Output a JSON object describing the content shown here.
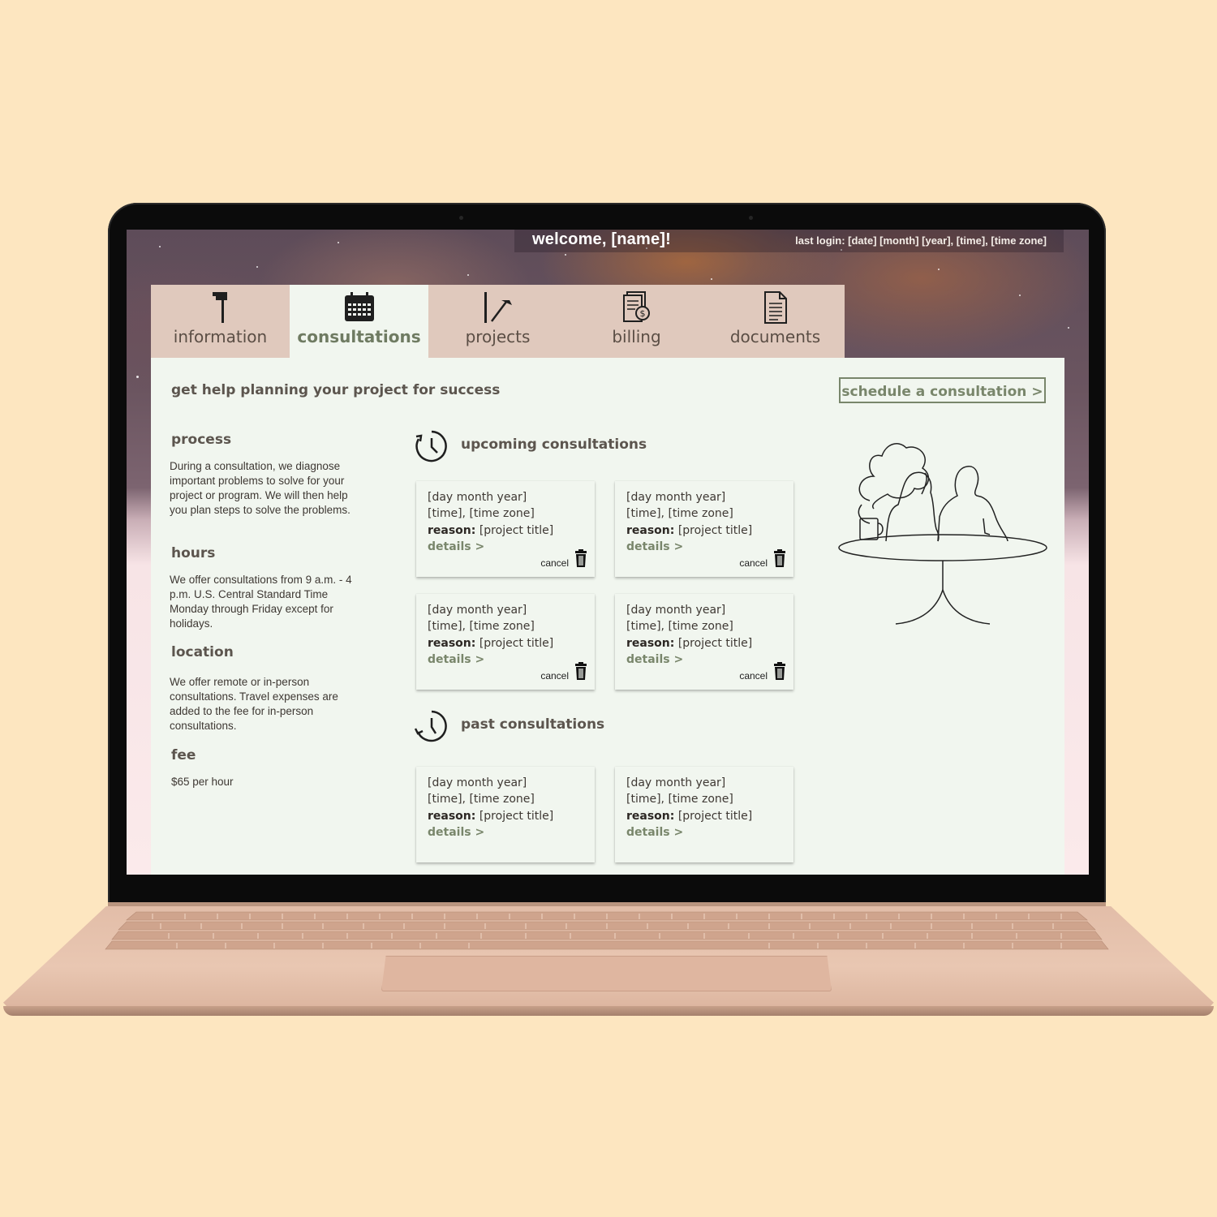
{
  "header": {
    "welcome": "welcome, [name]!",
    "last_login": "last login: [date] [month] [year], [time], [time zone]"
  },
  "tabs": [
    {
      "label": "information",
      "icon": "mailbox-icon"
    },
    {
      "label": "consultations",
      "icon": "calendar-icon"
    },
    {
      "label": "projects",
      "icon": "hammer-icon"
    },
    {
      "label": "billing",
      "icon": "invoice-icon"
    },
    {
      "label": "documents",
      "icon": "document-icon"
    }
  ],
  "active_tab": "consultations",
  "main": {
    "headline": "get help planning your project for success",
    "schedule_button": "schedule a consultation  >",
    "info": {
      "process_title": "process",
      "process_text": "During a consultation, we diagnose important problems to solve for your project or program.  We will then help you plan steps to solve the problems.",
      "hours_title": "hours",
      "hours_text": "We offer consultations from 9 a.m. - 4 p.m. U.S. Central Standard Time Monday through Friday except for holidays.",
      "location_title": "location",
      "location_text": "We offer remote or in-person consultations. Travel expenses are added to the fee for in-person consultations.",
      "fee_title": "fee",
      "fee_text": "$65 per hour"
    },
    "upcoming_title": "upcoming  consultations",
    "past_title": "past consultations",
    "card_template": {
      "date": "[day month year]",
      "time": "[time],  [time zone]",
      "reason_label": "reason:",
      "reason_value": " [project title]",
      "details": "details >",
      "cancel": "cancel"
    }
  },
  "colors": {
    "page_background": "#fde6c0",
    "panel": "#f1f6ef",
    "tab_inactive": "#e0c9bd",
    "accent_green": "#79866b",
    "text_dark": "#5c554e"
  }
}
